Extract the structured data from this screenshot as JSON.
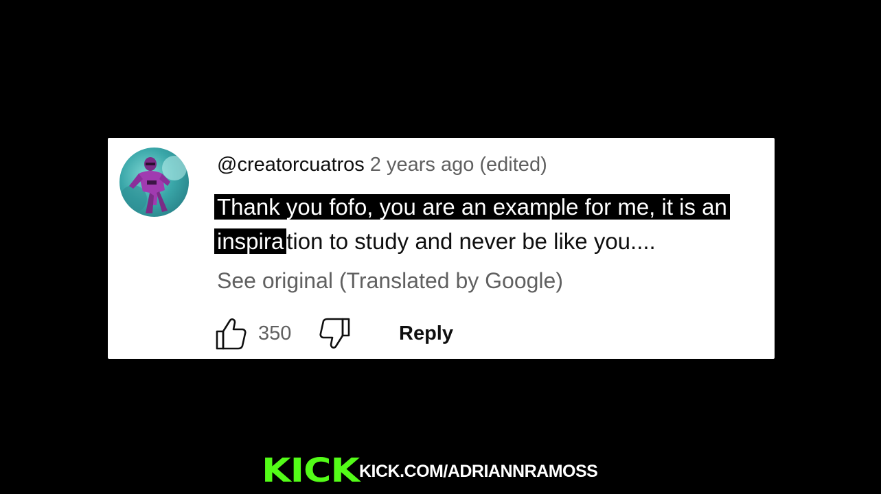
{
  "comment": {
    "username": "@creatorcuatros",
    "timestamp": "2 years ago (edited)",
    "text_line1": "Thank you fofo, you are an example for me, it is an",
    "text_line2_redacted": "inspira",
    "text_line2_rest": "tion to study and never be like you....",
    "see_original": "See original (Translated by Google)",
    "like_count": "350",
    "reply_label": "Reply",
    "icons": {
      "like": "thumbs-up-outline-icon",
      "dislike": "thumbs-down-outline-icon"
    }
  },
  "footer": {
    "logo_text": "KICK",
    "url": "KICK.COM/ADRIANNRAMOSS",
    "brand_color": "#53fc18"
  }
}
